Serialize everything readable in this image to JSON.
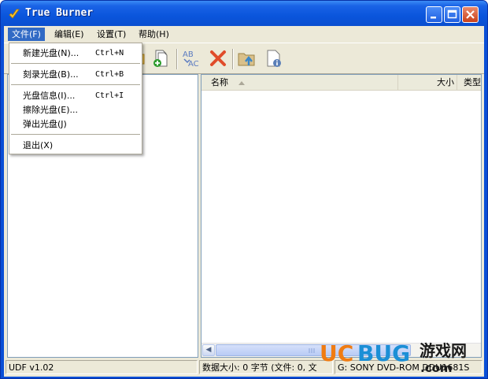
{
  "window": {
    "title": "True Burner"
  },
  "menubar": {
    "items": [
      {
        "label": "文件(F)"
      },
      {
        "label": "编辑(E)"
      },
      {
        "label": "设置(T)"
      },
      {
        "label": "帮助(H)"
      }
    ]
  },
  "file_menu": {
    "items": [
      {
        "label": "新建光盘(N)...",
        "shortcut": "Ctrl+N"
      },
      {
        "label": "刻录光盘(B)...",
        "shortcut": "Ctrl+B"
      },
      {
        "label": "光盘信息(I)...",
        "shortcut": "Ctrl+I"
      },
      {
        "label": "擦除光盘(E)...",
        "shortcut": ""
      },
      {
        "label": "弹出光盘(J)",
        "shortcut": ""
      },
      {
        "label": "退出(X)",
        "shortcut": ""
      }
    ]
  },
  "listview": {
    "columns": [
      {
        "label": "名称"
      },
      {
        "label": "大小"
      },
      {
        "label": "类型"
      }
    ]
  },
  "statusbar": {
    "format": "UDF v1.02",
    "info": "数据大小: 0 字节 (文件: 0, 文",
    "drive": "G: SONY DVD-ROM DDU1681S"
  },
  "watermark": {
    "brand_a": "UC",
    "brand_b": "BUG",
    "cn": "游戏网",
    "suffix": ".com"
  },
  "colors": {
    "titlebar": "#0a55dc",
    "menu_highlight": "#316ac5",
    "watermark_orange": "#f07c12",
    "watermark_blue": "#1b8fd6"
  }
}
